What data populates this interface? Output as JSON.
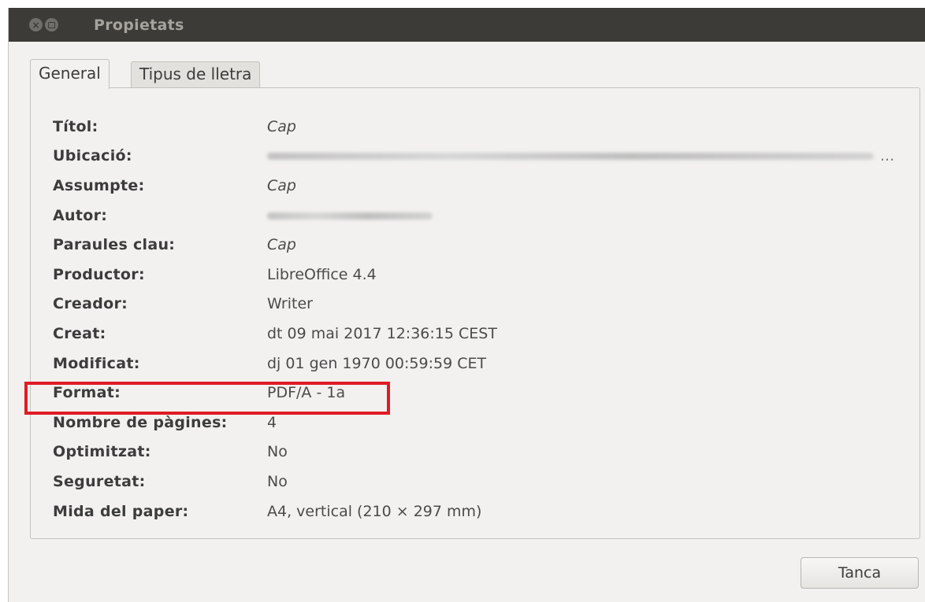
{
  "window": {
    "title": "Propietats"
  },
  "tabs": [
    {
      "label": "General",
      "active": true
    },
    {
      "label": "Tipus de lletra",
      "active": false
    }
  ],
  "properties": [
    {
      "label": "Títol:",
      "value": "Cap",
      "italic": true
    },
    {
      "label": "Ubicació:",
      "value": "",
      "redacted": true
    },
    {
      "label": "Assumpte:",
      "value": "Cap",
      "italic": true
    },
    {
      "label": "Autor:",
      "value": "",
      "redacted": true
    },
    {
      "label": "Paraules clau:",
      "value": "Cap",
      "italic": true
    },
    {
      "label": "Productor:",
      "value": "LibreOffice 4.4"
    },
    {
      "label": "Creador:",
      "value": "Writer"
    },
    {
      "label": "Creat:",
      "value": "dt 09 mai 2017 12:36:15 CEST"
    },
    {
      "label": "Modificat:",
      "value": "dj 01 gen 1970 00:59:59 CET"
    },
    {
      "label": "Format:",
      "value": "PDF/A - 1a"
    },
    {
      "label": "Nombre de pàgines:",
      "value": "4"
    },
    {
      "label": "Optimitzat:",
      "value": "No"
    },
    {
      "label": "Seguretat:",
      "value": "No"
    },
    {
      "label": "Mida del paper:",
      "value": "A4, vertical (210 × 297 mm)"
    }
  ],
  "ubicacio_ellipsis": "...",
  "buttons": {
    "close_label": "Tanca"
  },
  "colors": {
    "titlebar": "#3c3b37",
    "highlight": "#e01b24"
  }
}
